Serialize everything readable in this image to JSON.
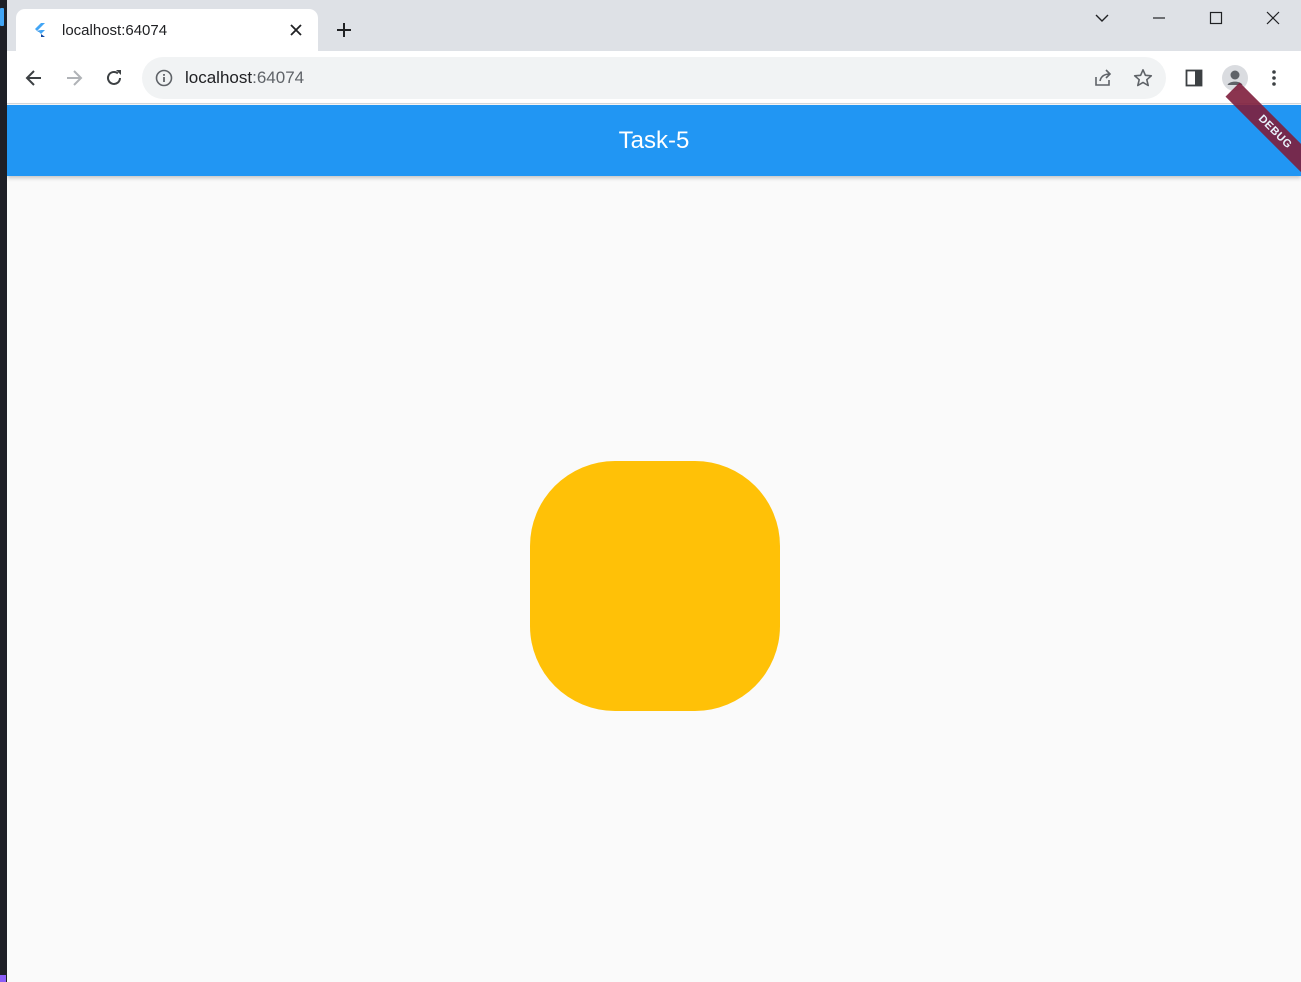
{
  "browser": {
    "tab": {
      "title": "localhost:64074",
      "favicon": "flutter-icon"
    },
    "address_bar": {
      "host": "localhost",
      "port": ":64074"
    },
    "icons": {
      "back": "back-arrow-icon",
      "forward": "forward-arrow-icon",
      "reload": "reload-icon",
      "info": "info-icon",
      "share": "share-icon",
      "bookmark": "star-icon",
      "side_panel": "side-panel-icon",
      "profile": "profile-icon",
      "menu": "kebab-menu-icon"
    }
  },
  "app": {
    "title": "Task-5",
    "debug_banner": "DEBUG",
    "colors": {
      "appbar": "#2196f3",
      "box": "#ffc107",
      "background": "#fafafa",
      "banner": "#7f1f3d"
    }
  }
}
